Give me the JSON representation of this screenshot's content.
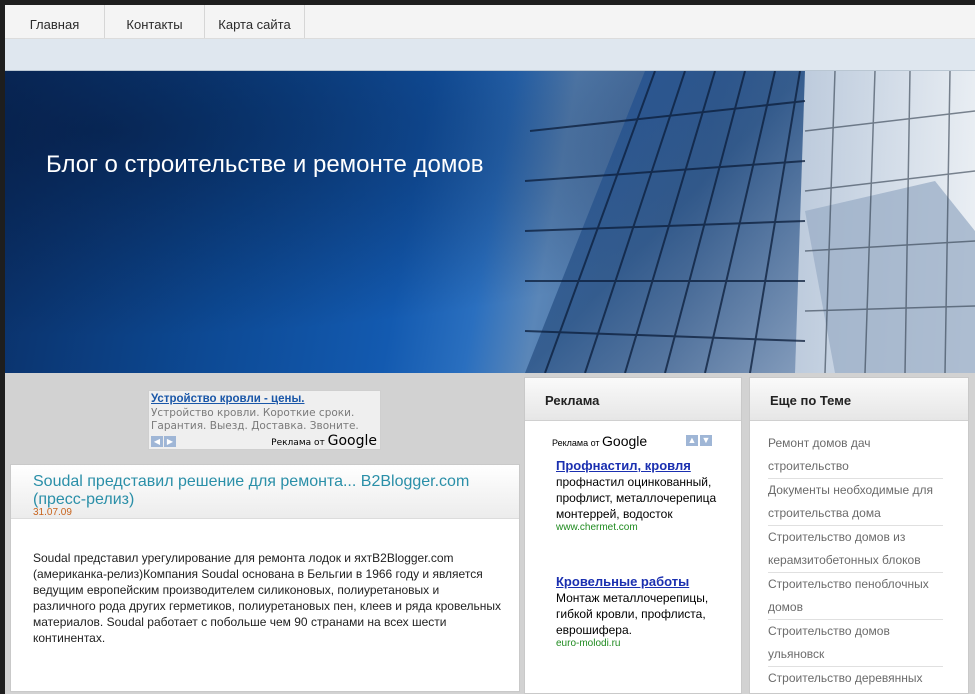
{
  "nav": {
    "items": [
      "Главная",
      "Контакты",
      "Карта сайта"
    ]
  },
  "header": {
    "title": "Блог о строительстве и ремонте домов"
  },
  "top_ad": {
    "title": "Устройство кровли - цены.",
    "text": "Устройство кровли. Короткие сроки. Гарантия. Выезд. Доставка. Звоните.",
    "attribution": "Реклама от",
    "brand": "Google"
  },
  "post": {
    "title": "Soudal представил решение для ремонта... B2Blogger.com (пресс-релиз)",
    "date": "31.07.09",
    "body": "Soudal представил урегулирование для ремонта лодок и яхтB2Blogger.com (американка-релиз)Компания Soudal основана в Бельгии в 1966 году и является ведущим европейским производителем силиконовых, полиуретановых и различного рода других герметиков, полиуретановых пен, клеев и ряда кровельных материалов. Soudal работает с побольше чем 90 странами на всех шести континентах."
  },
  "ads_column": {
    "heading": "Реклама",
    "attribution": "Реклама от",
    "brand": "Google",
    "items": [
      {
        "title": "Профнастил, кровля",
        "text": "профнастил оцинкованный, профлист, металлочерепица монтеррей, водосток",
        "url": "www.chermet.com"
      },
      {
        "title": "Кровельные работы",
        "text": "Монтаж металлочерепицы, гибкой кровли, профлиста, еврошифера.",
        "url": "euro-molodi.ru"
      }
    ]
  },
  "topics_column": {
    "heading": "Еще по Теме",
    "items": [
      "Ремонт домов дач строительство",
      "Документы необходимые для строительства дома",
      "Строительство домов из керамзитобетонных блоков",
      "Строительство пеноблочных домов",
      "Строительство домов ульяновск",
      "Строительство деревянных домов в самаре"
    ]
  },
  "colors": {
    "post_title": "#2a8fa8",
    "post_date": "#c8641e",
    "ad_link": "#1a2fb0",
    "ad_url": "#1e8a1e"
  }
}
